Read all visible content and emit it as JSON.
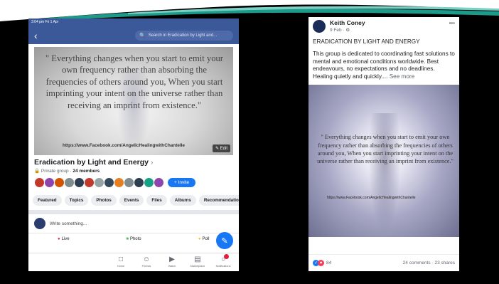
{
  "left": {
    "status_time": "3:04 pm  Fri 1 Apr",
    "search_placeholder": "Search in Eradication by Light and...",
    "cover_quote": "\" Everything changes when you start to emit your own frequency rather than absorbing the frequencies of others around you, When you start imprinting your intent on the universe rather than receiving an imprint from existence.\"",
    "cover_url": "https://www.Facebook.com/AngelicHealingwithChantelle",
    "edit_label": "Edit",
    "group_name": "Eradication by Light and Energy",
    "privacy": "Private group",
    "members": "24 members",
    "invite_label": "+ Invite",
    "tabs": [
      "Featured",
      "Topics",
      "Photos",
      "Events",
      "Files",
      "Albums",
      "Recommendations"
    ],
    "composer_placeholder": "Write something...",
    "actions": {
      "live": "Live",
      "photo": "Photo",
      "poll": "Poll"
    },
    "nav": {
      "home": "Home",
      "friends": "Friends",
      "watch": "Watch",
      "marketplace": "Marketplace",
      "notifications": "Notifications"
    },
    "member_colors": [
      "#c0392b",
      "#8e44ad",
      "#d35400",
      "#7f8c8d",
      "#2c3e50",
      "#c0392b",
      "#95a5a6",
      "#34495e",
      "#e67e22",
      "#7f8c8d",
      "#2c3e50",
      "#16a085",
      "#8e44ad"
    ]
  },
  "right": {
    "author": "Keith Coney",
    "date": "9 Feb · ⚙",
    "title": "ERADICATION BY LIGHT AND ENERGY",
    "body": "This group is dedicated to coordinating fast solutions to mental and emotional conditions worldwide. Best endeavours, no expectations and no deadlines. Healing quietly and quickly....",
    "see_more": "See more",
    "image_quote": "\" Everything changes when you start to emit your own frequency rather than absorbing the frequencies of others around you, When you start imprinting your intent on the universe rather than receiving an imprint from existence.\"",
    "image_url": "https://www.Facebook.com/AngelicHealingwithChantelle",
    "reaction_count": "84",
    "stats": "24 comments · 23 shares"
  }
}
